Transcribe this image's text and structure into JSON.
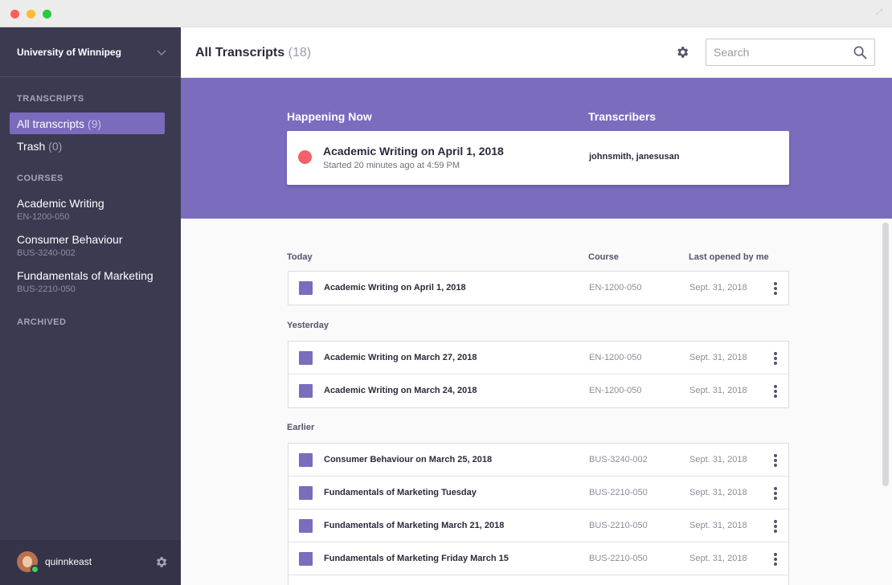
{
  "sidebar": {
    "org_name": "University of Winnipeg",
    "transcripts_label": "TRANSCRIPTS",
    "nav": [
      {
        "label": "All transcripts",
        "count": "(9)"
      },
      {
        "label": "Trash",
        "count": "(0)"
      }
    ],
    "courses_label": "COURSES",
    "courses": [
      {
        "name": "Academic Writing",
        "code": "EN-1200-050"
      },
      {
        "name": "Consumer Behaviour",
        "code": "BUS-3240-002"
      },
      {
        "name": "Fundamentals of Marketing",
        "code": "BUS-2210-050"
      }
    ],
    "archived_label": "ARCHIVED",
    "username": "quinnkeast"
  },
  "header": {
    "title": "All Transcripts",
    "count": "(18)",
    "search_placeholder": "Search"
  },
  "happening": {
    "label": "Happening Now",
    "transcribers_label": "Transcribers",
    "title": "Academic Writing on April 1, 2018",
    "subtitle": "Started 20 minutes ago at 4:59 PM",
    "transcribers": "johnsmith, janesusan"
  },
  "list": {
    "col_course": "Course",
    "col_opened": "Last opened by me",
    "groups": [
      {
        "label": "Today",
        "rows": [
          {
            "title": "Academic Writing on April 1, 2018",
            "course": "EN-1200-050",
            "date": "Sept. 31, 2018"
          }
        ]
      },
      {
        "label": "Yesterday",
        "rows": [
          {
            "title": "Academic Writing on March 27, 2018",
            "course": "EN-1200-050",
            "date": "Sept. 31, 2018"
          },
          {
            "title": "Academic Writing on March 24, 2018",
            "course": "EN-1200-050",
            "date": "Sept. 31, 2018"
          }
        ]
      },
      {
        "label": "Earlier",
        "rows": [
          {
            "title": "Consumer Behaviour on March 25, 2018",
            "course": "BUS-3240-002",
            "date": "Sept. 31, 2018"
          },
          {
            "title": "Fundamentals of Marketing Tuesday",
            "course": "BUS-2210-050",
            "date": "Sept. 31, 2018"
          },
          {
            "title": "Fundamentals of Marketing March 21, 2018",
            "course": "BUS-2210-050",
            "date": "Sept. 31, 2018"
          },
          {
            "title": "Fundamentals of Marketing Friday March 15",
            "course": "BUS-2210-050",
            "date": "Sept. 31, 2018"
          }
        ]
      }
    ]
  },
  "colors": {
    "accent": "#7b6cbe",
    "sidebar": "#3c3a51",
    "live": "#f2606a",
    "online": "#3ad35b"
  }
}
